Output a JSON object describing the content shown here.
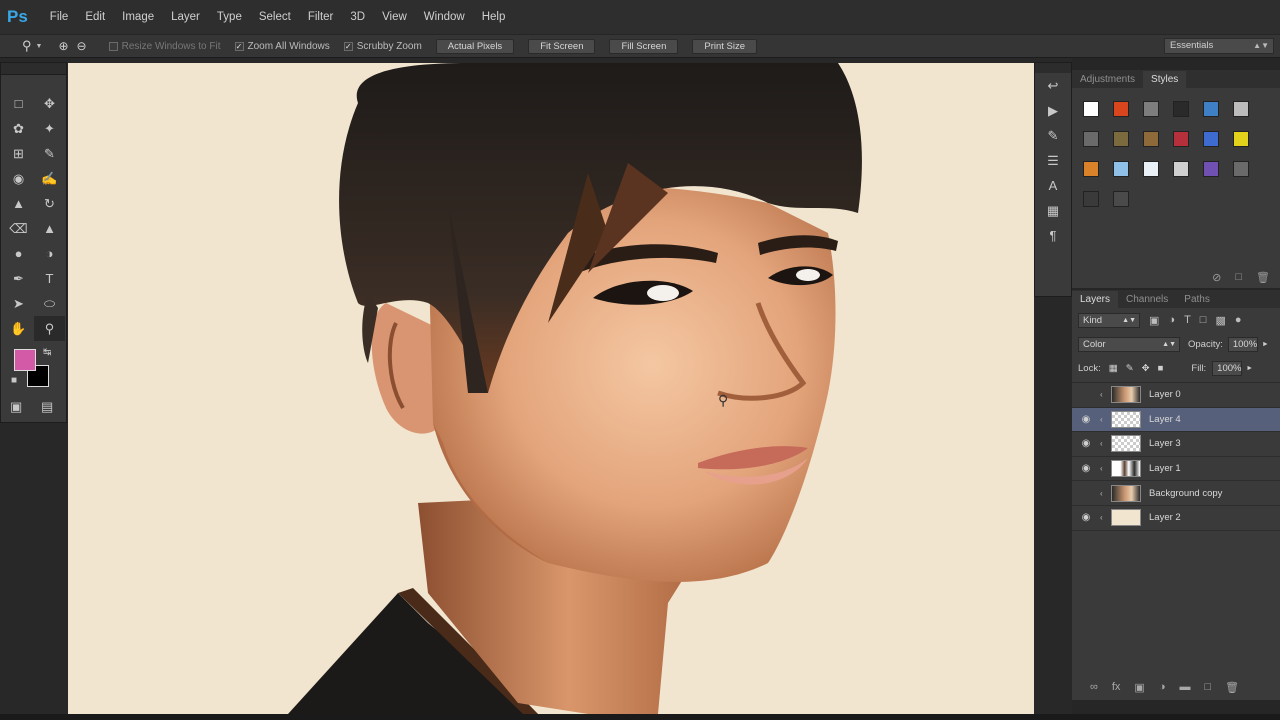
{
  "app": {
    "logo": "Ps",
    "menu": [
      "File",
      "Edit",
      "Image",
      "Layer",
      "Type",
      "Select",
      "Filter",
      "3D",
      "View",
      "Window",
      "Help"
    ]
  },
  "options_bar": {
    "resize_windows": "Resize Windows to Fit",
    "zoom_all": "Zoom All Windows",
    "scrubby_zoom": "Scrubby Zoom",
    "buttons": [
      "Actual Pixels",
      "Fit Screen",
      "Fill Screen",
      "Print Size"
    ],
    "workspace": "Essentials"
  },
  "panels": {
    "top_tabs": [
      "Adjustments",
      "Styles"
    ],
    "styles_colors": [
      "#ffffff",
      "#d9461e",
      "#7d7d7d",
      "#2a2a2a",
      "#3f7fc6",
      "#bcbcbc",
      "#6a6a6a",
      "#7a6a3e",
      "#8e6a3a",
      "#b5303a",
      "#3e6bd0",
      "#e2d21c",
      "#d9822a",
      "#8fc0e8",
      "#e9f1f6",
      "#cfcfcf",
      "#7050b0",
      "#6a6a6a",
      "#3a3a3a",
      "#4a4a4a"
    ],
    "layer_tabs": [
      "Layers",
      "Channels",
      "Paths"
    ],
    "kind": "Kind",
    "blend_mode": "Color",
    "opacity_label": "Opacity:",
    "opacity_value": "100%",
    "lock_label": "Lock:",
    "fill_label": "Fill:",
    "fill_value": "100%"
  },
  "layers": [
    {
      "name": "Layer 0",
      "visible": false,
      "thumb": "photo",
      "selected": false
    },
    {
      "name": "Layer 4",
      "visible": true,
      "thumb": "check",
      "selected": true
    },
    {
      "name": "Layer 3",
      "visible": true,
      "thumb": "check",
      "selected": false
    },
    {
      "name": "Layer 1",
      "visible": true,
      "thumb": "mixed",
      "selected": false
    },
    {
      "name": "Background copy",
      "visible": false,
      "thumb": "photo",
      "selected": false
    },
    {
      "name": "Layer 2",
      "visible": true,
      "thumb": "cream",
      "selected": false
    }
  ],
  "colors": {
    "foreground": "#d35aa6",
    "background": "#000000",
    "canvas_bg": "#f1e5cf"
  }
}
